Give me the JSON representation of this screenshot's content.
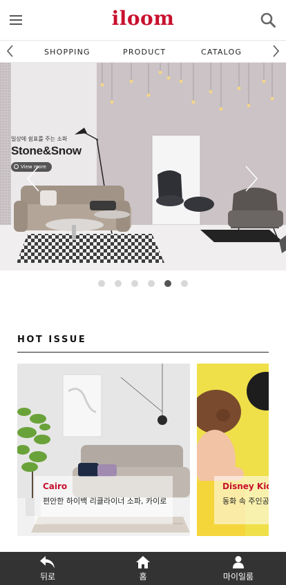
{
  "header": {
    "logo": "iloom",
    "menu_icon": "hamburger-menu-icon",
    "search_icon": "search-icon"
  },
  "category_nav": {
    "items": [
      "SHOPPING",
      "PRODUCT",
      "CATALOG"
    ]
  },
  "hero": {
    "subtitle": "일상에 쉼표를 주는 소파",
    "title": "Stone&Snow",
    "button": "View more",
    "slide_count": 6,
    "active_slide": 5
  },
  "hot_issue": {
    "title": "HOT ISSUE",
    "cards": [
      {
        "name": "Cairo",
        "description": "편안한 하이백 리클라이너 소파, 카이로"
      },
      {
        "name": "Disney Kid",
        "description": "동화 속 주인공 미키 안전 거"
      }
    ]
  },
  "bottom_bar": {
    "tabs": [
      {
        "label": "뒤로",
        "icon": "back-arrow-icon"
      },
      {
        "label": "홈",
        "icon": "home-icon"
      },
      {
        "label": "마이일룸",
        "icon": "user-icon"
      }
    ]
  }
}
